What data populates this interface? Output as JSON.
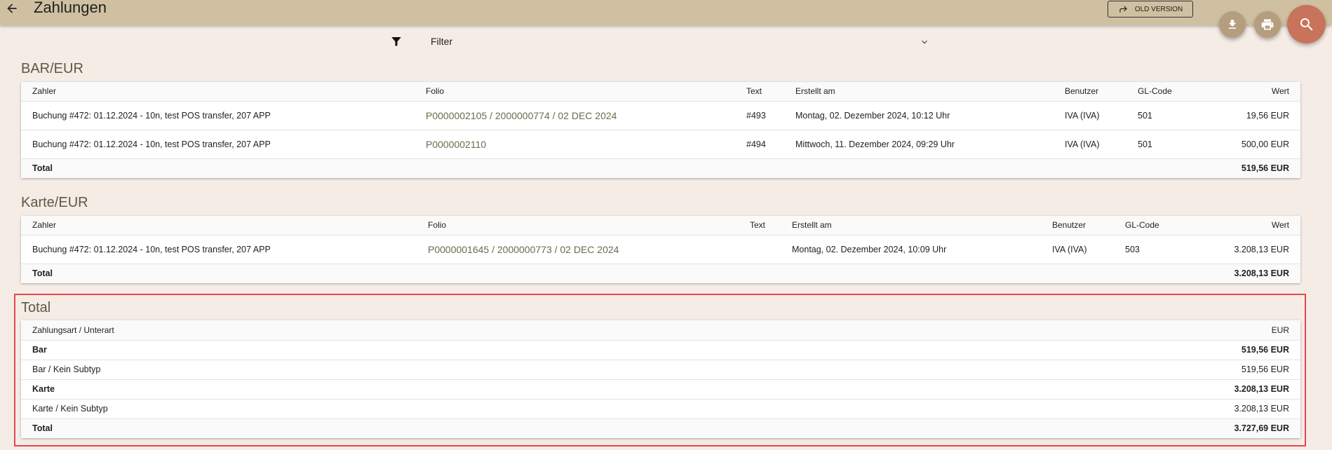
{
  "header": {
    "title": "Zahlungen",
    "old_version_label": "OLD VERSION"
  },
  "filter": {
    "label": "Filter"
  },
  "bar_eur": {
    "title": "BAR/EUR",
    "columns": [
      "Zahler",
      "Folio",
      "Text",
      "Erstellt am",
      "Benutzer",
      "GL-Code",
      "Wert"
    ],
    "rows": [
      [
        "Buchung #472: 01.12.2024 - 10n, test POS transfer, 207 APP",
        "P0000002105 / 2000000774 / 02 DEC 2024",
        "#493",
        "Montag, 02. Dezember 2024, 10:12 Uhr",
        "IVA (IVA)",
        "501",
        "19,56 EUR"
      ],
      [
        "Buchung #472: 01.12.2024 - 10n, test POS transfer, 207 APP",
        "P0000002110",
        "#494",
        "Mittwoch, 11. Dezember 2024, 09:29 Uhr",
        "IVA (IVA)",
        "501",
        "500,00 EUR"
      ]
    ],
    "total_label": "Total",
    "total_value": "519,56 EUR"
  },
  "karte_eur": {
    "title": "Karte/EUR",
    "columns": [
      "Zahler",
      "Folio",
      "Text",
      "Erstellt am",
      "Benutzer",
      "GL-Code",
      "Wert"
    ],
    "rows": [
      [
        "Buchung #472: 01.12.2024 - 10n, test POS transfer, 207 APP",
        "P0000001645 / 2000000773 / 02 DEC 2024",
        "",
        "Montag, 02. Dezember 2024, 10:09 Uhr",
        "IVA (IVA)",
        "503",
        "3.208,13 EUR"
      ]
    ],
    "total_label": "Total",
    "total_value": "3.208,13 EUR"
  },
  "summary": {
    "title": "Total",
    "columns": [
      "Zahlungsart / Unterart",
      "EUR"
    ],
    "rows": [
      [
        "Bar",
        "519,56 EUR"
      ],
      [
        "Bar / Kein Subtyp",
        "519,56 EUR"
      ],
      [
        "Karte",
        "3.208,13 EUR"
      ],
      [
        "Karte / Kein Subtyp",
        "3.208,13 EUR"
      ],
      [
        "Total",
        "3.727,69 EUR"
      ]
    ]
  },
  "colors": {
    "topbar": "#cfc0a1",
    "background": "#f5ece6",
    "accent_fab": "#b59e7d",
    "search_fab": "#c8735b",
    "highlight_border": "#e5484d"
  }
}
